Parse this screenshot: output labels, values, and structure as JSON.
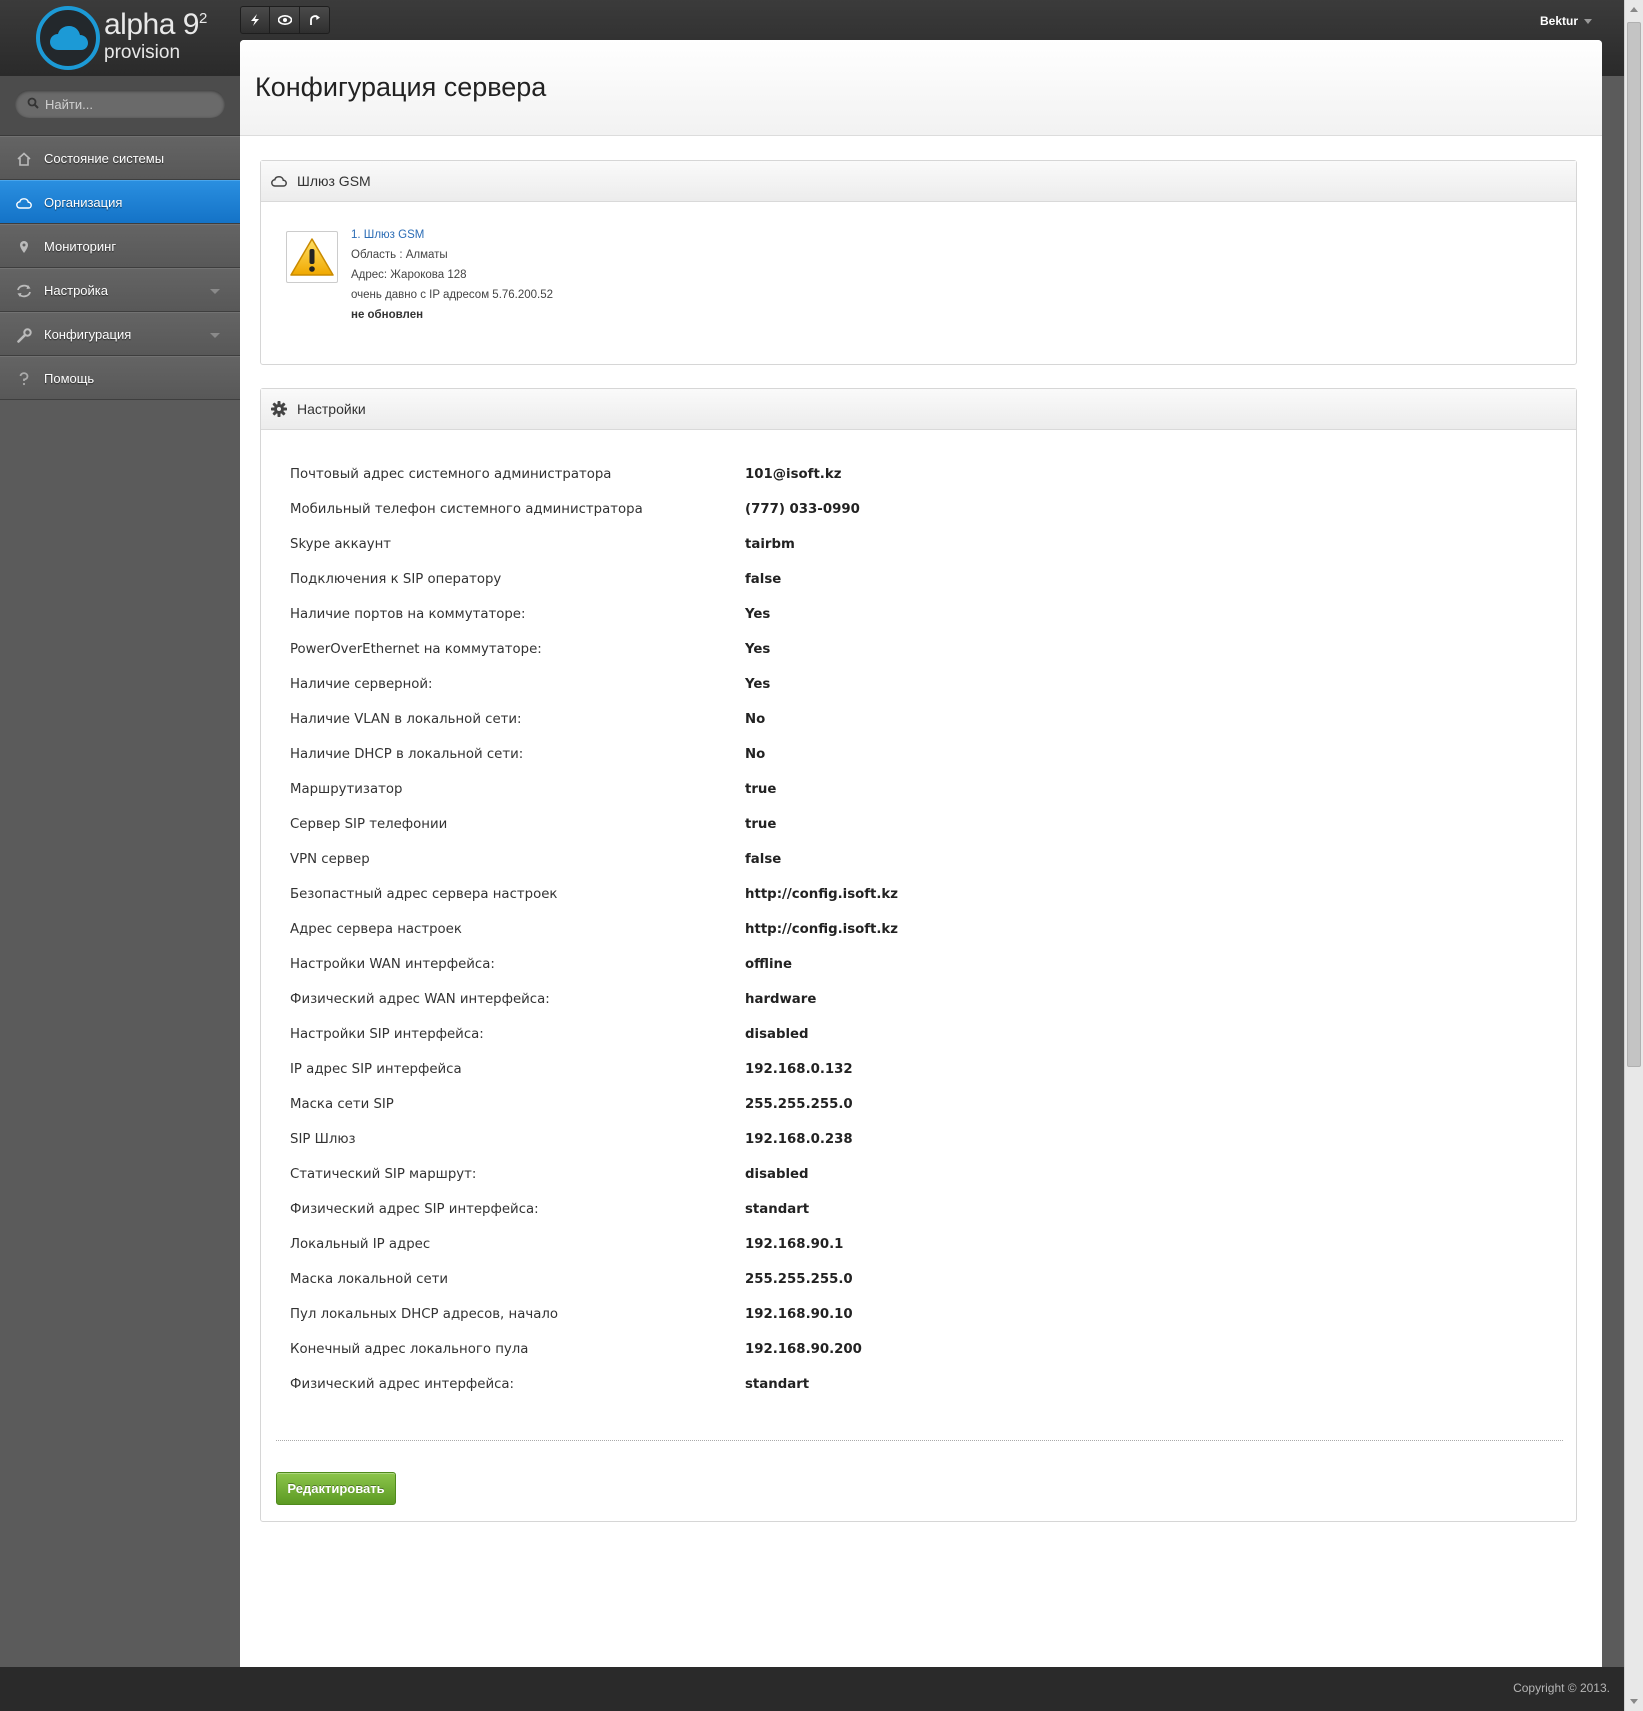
{
  "brand": {
    "name": "alpha 9",
    "superscript": "2",
    "subtitle": "provision",
    "accent": "#1c9ad6"
  },
  "toolbar": {
    "icons": [
      "bolt-icon",
      "eye-icon",
      "redo-icon"
    ]
  },
  "user": {
    "name": "Bektur"
  },
  "search": {
    "placeholder": "Найти..."
  },
  "sidebar": {
    "items": [
      {
        "label": "Состояние системы",
        "icon": "home-icon",
        "active": false
      },
      {
        "label": "Организация",
        "icon": "cloud-icon",
        "active": true
      },
      {
        "label": "Мониторинг",
        "icon": "map-pin-icon",
        "active": false
      },
      {
        "label": "Настройка",
        "icon": "sync-icon",
        "active": false,
        "submenu": true
      },
      {
        "label": "Конфигурация",
        "icon": "wrench-icon",
        "active": false,
        "submenu": true
      },
      {
        "label": "Помощь",
        "icon": "question-icon",
        "active": false
      }
    ]
  },
  "page": {
    "title": "Конфигурация сервера"
  },
  "gateway": {
    "section_title": "Шлюз GSM",
    "link": "1. Шлюз GSM",
    "region": "Область : Алматы",
    "address": "Адрес: Жарокова 128",
    "last_seen": "очень давно с IP адресом 5.76.200.52",
    "status": "не обновлен"
  },
  "settings": {
    "section_title": "Настройки",
    "rows": [
      {
        "label": "Почтовый адрес системного администратора",
        "value": "101@isoft.kz"
      },
      {
        "label": "Мобильный телефон системного администратора",
        "value": "(777) 033-0990"
      },
      {
        "label": "Skype аккаунт",
        "value": "tairbm"
      },
      {
        "label": "Подключения к SIP оператору",
        "value": "false"
      },
      {
        "label": "Наличие портов на коммутаторе:",
        "value": "Yes"
      },
      {
        "label": "PowerOverEthernet на коммутаторе:",
        "value": "Yes"
      },
      {
        "label": "Наличие серверной:",
        "value": "Yes"
      },
      {
        "label": "Наличие VLAN в локальной сети:",
        "value": "No"
      },
      {
        "label": "Наличие DHCP в локальной сети:",
        "value": "No"
      },
      {
        "label": "Маршрутизатор",
        "value": "true"
      },
      {
        "label": "Сервер SIP телефонии",
        "value": "true"
      },
      {
        "label": "VPN сервер",
        "value": "false"
      },
      {
        "label": "Безопастный адрес сервера настроек",
        "value": "http://config.isoft.kz"
      },
      {
        "label": "Адрес сервера настроек",
        "value": "http://config.isoft.kz"
      },
      {
        "label": "Настройки WAN интерфейса:",
        "value": "offline"
      },
      {
        "label": "Физический адрес WAN интерфейса:",
        "value": "hardware"
      },
      {
        "label": "Настройки SIP интерфейса:",
        "value": "disabled"
      },
      {
        "label": "IP адрес SIP интерфейса",
        "value": "192.168.0.132"
      },
      {
        "label": "Маска сети SIP",
        "value": "255.255.255.0"
      },
      {
        "label": "SIP Шлюз",
        "value": "192.168.0.238"
      },
      {
        "label": "Статический SIP маршрут:",
        "value": "disabled"
      },
      {
        "label": "Физический адрес SIP интерфейса:",
        "value": "standart"
      },
      {
        "label": "Локальный IP адрес",
        "value": "192.168.90.1"
      },
      {
        "label": "Маска локальной сети",
        "value": "255.255.255.0"
      },
      {
        "label": "Пул локальных DHCP адресов, начало",
        "value": "192.168.90.10"
      },
      {
        "label": "Конечный адрес локального пула",
        "value": "192.168.90.200"
      },
      {
        "label": "Физический адрес интерфейса:",
        "value": "standart"
      }
    ],
    "edit_label": "Редактировать"
  },
  "footer": {
    "copyright": "Copyright © 2013."
  }
}
